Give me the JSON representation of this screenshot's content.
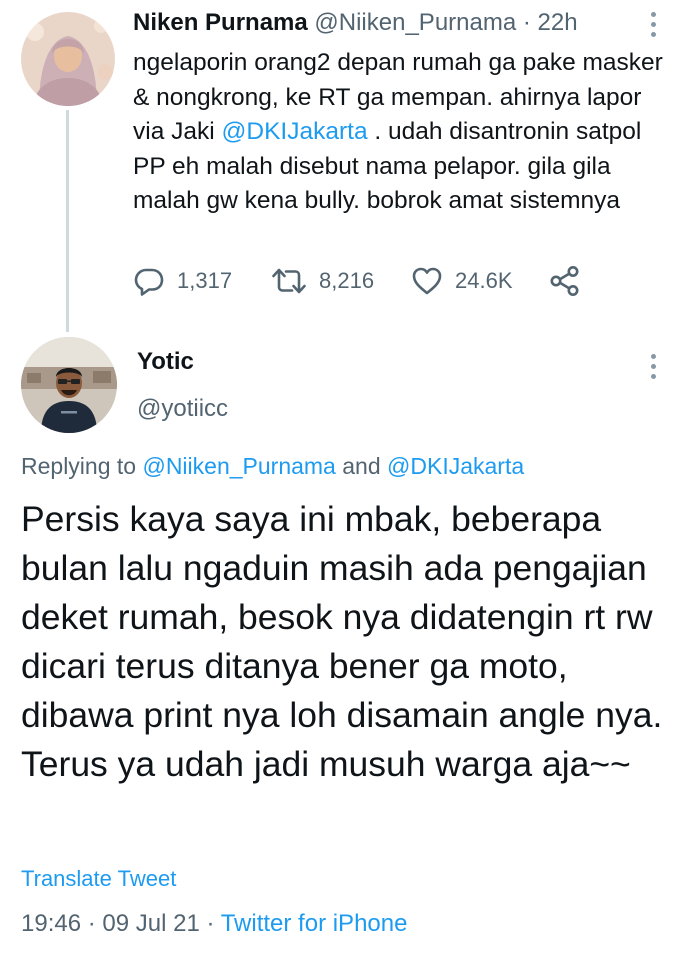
{
  "tweet1": {
    "author_name": "Niken Purnama",
    "author_handle": "@Niiken_Purnama",
    "separator": " · ",
    "time": "22h",
    "text_before_mention": "ngelaporin orang2 depan rumah ga pake masker & nongkrong, ke RT ga mempan. ahirnya lapor via Jaki ",
    "mention": "@DKIJakarta",
    "text_after_mention": " . udah disantronin satpol PP eh malah disebut nama pelapor. gila gila malah gw kena bully. bobrok amat sistemnya",
    "replies": "1,317",
    "retweets": "8,216",
    "likes": "24.6K",
    "icons": {
      "reply": "reply-icon",
      "retweet": "retweet-icon",
      "like": "heart-icon",
      "share": "share-icon",
      "more": "more-options-icon"
    }
  },
  "tweet2": {
    "author_name": "Yotic",
    "author_handle": "@yotiicc",
    "replying_prefix": "Replying to ",
    "replying_to_1": "@Niiken_Purnama",
    "replying_and": " and ",
    "replying_to_2": "@DKIJakarta",
    "text": "Persis kaya saya ini mbak, beberapa bulan lalu ngaduin masih ada pengajian deket rumah, besok nya didatengin rt rw dicari terus ditanya bener ga moto, dibawa print nya loh disamain angle nya. Terus ya udah jadi musuh warga aja~~",
    "translate_label": "Translate Tweet",
    "time": "19:46",
    "date_sep": " · ",
    "date": "09 Jul 21",
    "source_sep": " · ",
    "source": "Twitter for iPhone"
  },
  "colors": {
    "accent": "#1d9bf0",
    "text": "#0f1419",
    "secondary": "#536471",
    "thread_line": "#cfd9de"
  }
}
